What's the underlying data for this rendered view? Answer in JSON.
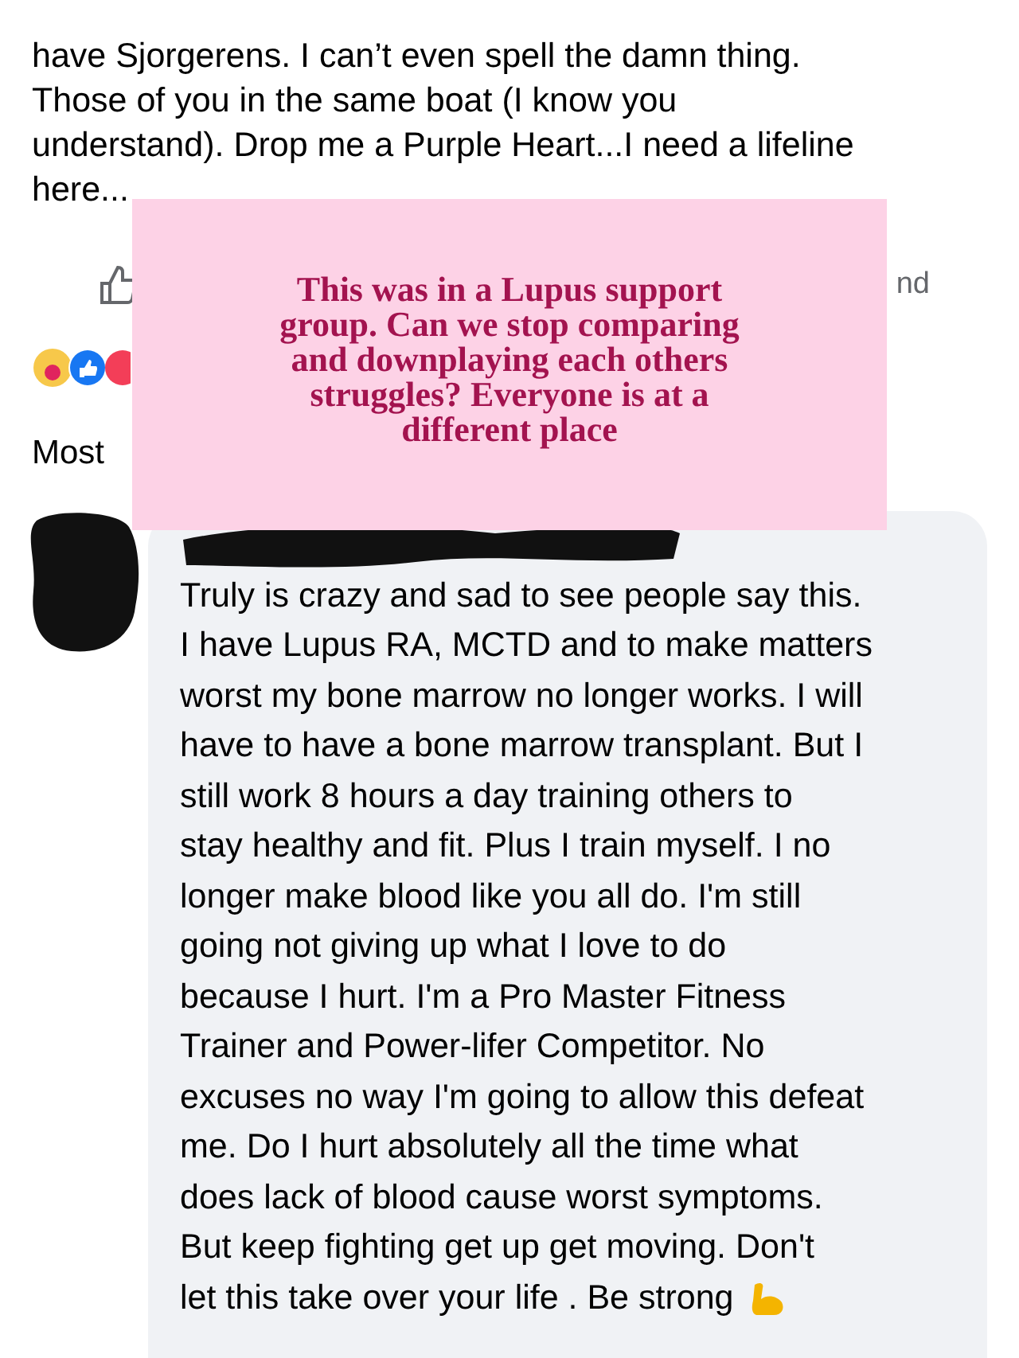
{
  "post": {
    "text": "have Sjorgerens. I can’t even spell the damn thing.\nThose of you in the same boat (I know you\nunderstand).  Drop me a Purple Heart...I need a lifeline\nhere..."
  },
  "actions": {
    "send_label_fragment": "nd"
  },
  "comments_sort": {
    "label": "Most"
  },
  "overlay": {
    "text": "This was in a Lupus support\ngroup. Can we stop comparing\nand downplaying each others\nstruggles? Everyone is at a\ndifferent place"
  },
  "comment": {
    "text": "Truly is crazy and sad to see people say this.\nI have Lupus RA, MCTD and to make matters\nworst my bone marrow no longer works. I will\nhave to have a bone marrow transplant. But I\nstill work 8 hours a day training others to\nstay healthy and fit. Plus I train myself. I no\nlonger make blood like you all do. I'm still\ngoing not giving up what I love to do\nbecause I hurt. I'm a Pro Master Fitness\nTrainer and Power-lifer Competitor. No\nexcuses no way I'm going to allow this defeat\nme. Do I hurt absolutely all the time what\ndoes lack of blood cause worst symptoms.\nBut keep fighting get up get moving. Don't\nlet this take over your life . Be strong"
  }
}
